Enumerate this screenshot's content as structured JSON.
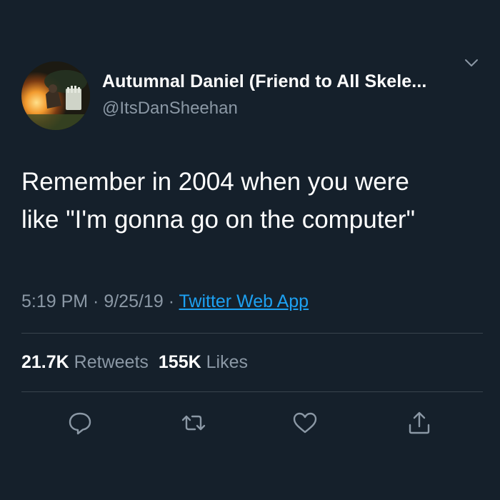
{
  "tweet": {
    "author": {
      "display_name": "Autumnal Daniel (Friend to All Skele...",
      "handle": "@ItsDanSheehan"
    },
    "text_lines": [
      "Remember in 2004 when you were",
      "like \"I'm gonna go on the computer\""
    ],
    "meta": {
      "time": "5:19 PM",
      "separator1": " · ",
      "date": "9/25/19",
      "separator2": " · ",
      "source": "Twitter Web App"
    },
    "stats": {
      "retweets_count": "21.7K",
      "retweets_label": "Retweets",
      "likes_count": "155K",
      "likes_label": "Likes"
    },
    "actions": [
      {
        "icon": "reply-icon"
      },
      {
        "icon": "retweet-icon"
      },
      {
        "icon": "like-icon"
      },
      {
        "icon": "share-icon"
      }
    ]
  },
  "colors": {
    "background": "#15202b",
    "primary_text": "#ffffff",
    "secondary_text": "#8b98a5",
    "accent": "#1da1f2",
    "divider": "#38444d"
  }
}
